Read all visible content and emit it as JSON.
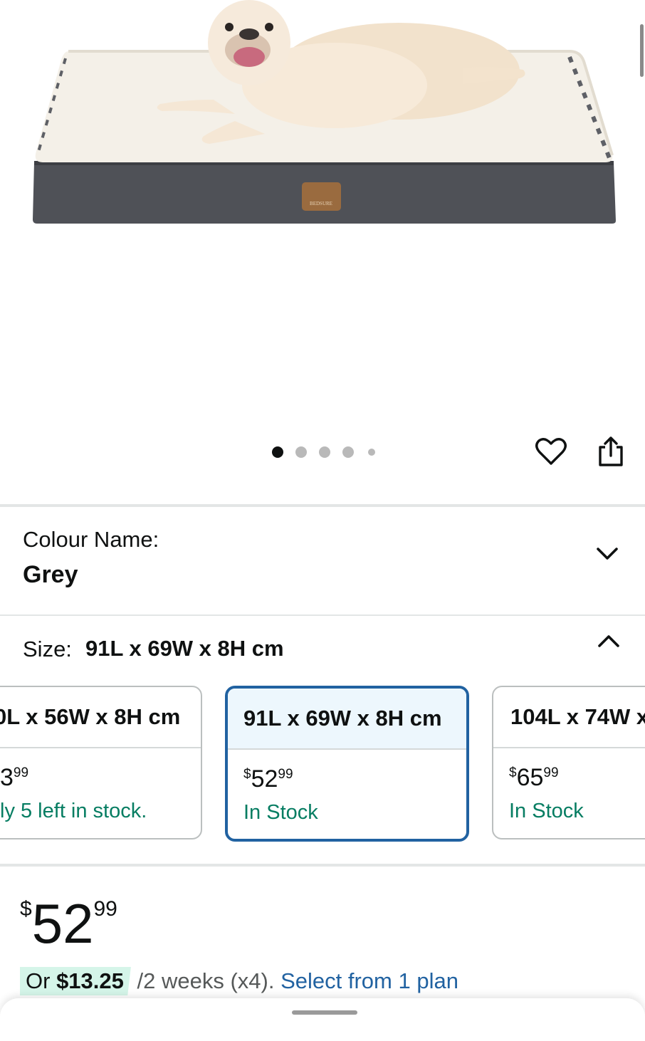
{
  "gallery": {
    "brand_mark": "BEDSURE",
    "slide_count": 5,
    "active_slide": 1
  },
  "actions": {
    "wishlist_icon": "heart-outline-icon",
    "share_icon": "share-icon"
  },
  "colour": {
    "label": "Colour Name:",
    "value": "Grey",
    "icon": "chevron-down-icon"
  },
  "size": {
    "label": "Size:",
    "value": "91L x 69W x 8H cm",
    "icon": "chevron-up-icon",
    "options": [
      {
        "label": "0L x 56W x 8H cm",
        "price_whole": "3",
        "price_fraction": "99",
        "price_symbol": "",
        "stock": "ly 5 left in stock."
      },
      {
        "label": "91L x 69W x 8H cm",
        "price_symbol": "$",
        "price_whole": "52",
        "price_fraction": "99",
        "stock": "In Stock"
      },
      {
        "label": "104L x 74W x",
        "price_symbol": "$",
        "price_whole": "65",
        "price_fraction": "99",
        "stock": "In Stock"
      }
    ]
  },
  "price": {
    "symbol": "$",
    "whole": "52",
    "fraction": "99"
  },
  "installment": {
    "prefix": "Or",
    "amount": "$13.25",
    "terms": "/2 weeks (x4).",
    "link": "Select from 1 plan"
  },
  "colors": {
    "link_blue": "#2162a1",
    "stock_green": "#067d62",
    "selected_border": "#2162a1",
    "badge_green": "#d5f5e9"
  }
}
